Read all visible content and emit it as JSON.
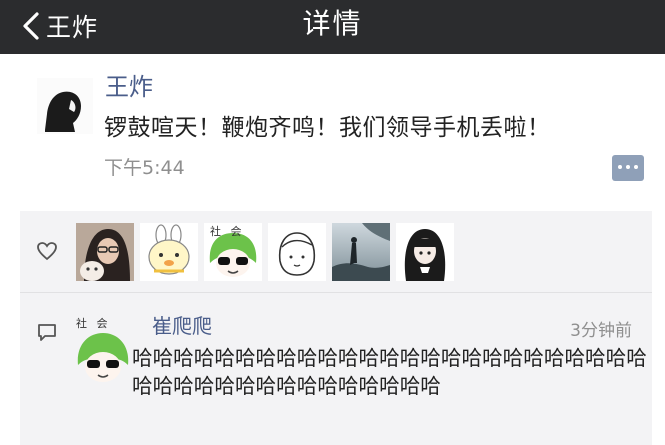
{
  "nav": {
    "back_label": "王炸",
    "title": "详情"
  },
  "post": {
    "author": "王炸",
    "content": "锣鼓喧天！鞭炮齐鸣！我们领导手机丢啦！",
    "time": "下午5:44"
  },
  "likes": {
    "avatars": [
      "avatar-photo-girl",
      "avatar-cartoon-rabbit",
      "avatar-green-hair-sticker",
      "avatar-line-drawing-face",
      "avatar-silhouette-scene",
      "avatar-anime-girl"
    ],
    "sticker_label": "社 会"
  },
  "comment": {
    "name": "崔爬爬",
    "time": "3分钟前",
    "text": "哈哈哈哈哈哈哈哈哈哈哈哈哈哈哈哈哈哈哈哈哈哈哈哈哈哈哈哈哈哈哈哈哈哈哈哈哈哈哈哈",
    "sticker_label": "社 会"
  },
  "colors": {
    "nav_bg": "#2b2c2e",
    "link": "#4a5d8a",
    "panel_bg": "#f3f3f5"
  }
}
